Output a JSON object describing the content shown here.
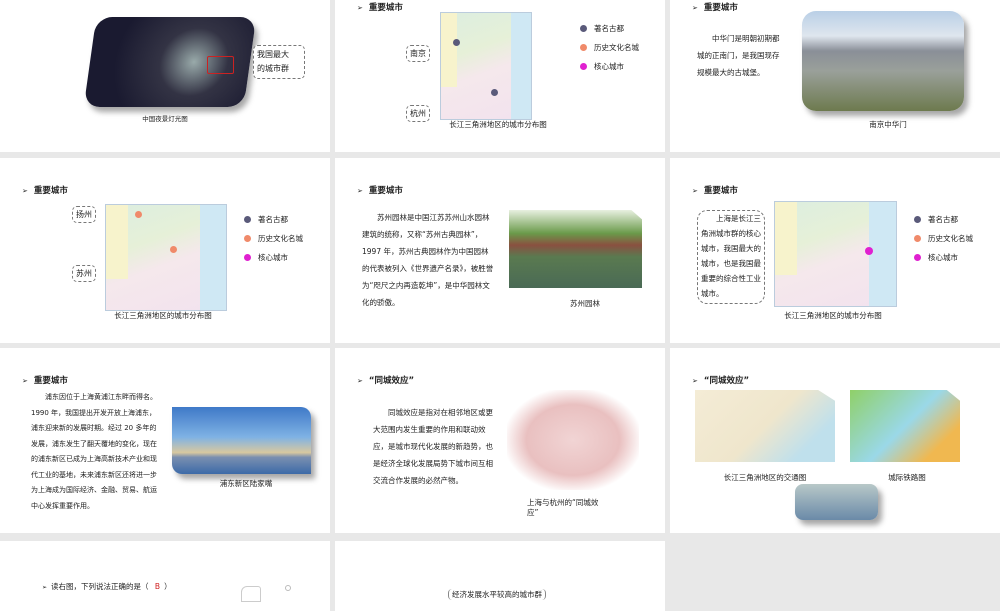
{
  "slides": [
    {
      "image_caption": "中国夜景灯光图",
      "callout": [
        "我国最大",
        "的城市群"
      ]
    },
    {
      "title": "重要城市",
      "callouts": [
        "南京",
        "杭州"
      ],
      "map_caption": "长江三角洲地区的城市分布图",
      "legend": [
        {
          "label": "著名古都",
          "color": "#5a5a7a"
        },
        {
          "label": "历史文化名城",
          "color": "#f08a6a"
        },
        {
          "label": "核心城市",
          "color": "#e020d0"
        }
      ]
    },
    {
      "title": "重要城市",
      "text": "中华门是明朝初期都城的正南门，是我国现存规模最大的古城堡。",
      "image_caption": "南京中华门"
    },
    {
      "title": "重要城市",
      "callouts": [
        "扬州",
        "苏州"
      ],
      "map_caption": "长江三角洲地区的城市分布图",
      "legend": [
        {
          "label": "著名古都",
          "color": "#5a5a7a"
        },
        {
          "label": "历史文化名城",
          "color": "#f08a6a"
        },
        {
          "label": "核心城市",
          "color": "#e020d0"
        }
      ]
    },
    {
      "title": "重要城市",
      "text": "苏州园林是中国江苏苏州山水园林建筑的统称，又称“苏州古典园林”， 1997 年，苏州古典园林作为中国园林的代表被列入《世界遗产名录》，被胜誉为“咫尺之内再造乾坤”，是中华园林文化的骄傲。",
      "image_caption": "苏州园林"
    },
    {
      "title": "重要城市",
      "callout": "上海是长江三角洲城市群的核心城市，我国最大的城市，也是我国最重要的综合性工业城市。",
      "map_caption": "长江三角洲地区的城市分布图",
      "legend": [
        {
          "label": "著名古都",
          "color": "#5a5a7a"
        },
        {
          "label": "历史文化名城",
          "color": "#f08a6a"
        },
        {
          "label": "核心城市",
          "color": "#e020d0"
        }
      ]
    },
    {
      "title": "重要城市",
      "text": "浦东因位于上海黄浦江东畔而得名。 1990 年，我国提出开发开放上海浦东，浦东迎来新的发展时期。经过 20 多年的发展，浦东发生了翻天覆地的变化，现在的浦东新区已成为上海高新技术产业和现代工业的基地，未来浦东新区还将进一步为上海成为国际经济、金融、贸易、航运中心发挥重要作用。",
      "image_caption": "浦东新区陆家嘴"
    },
    {
      "title": "“同城效应”",
      "text": "同城效应是指对在相邻地区或更大范围内发生重要的作用和联动效应，是城市现代化发展的新趋势，也是经济全球化发展局势下城市间互相交流合作发展的必然产物。",
      "image_caption": "上海与杭州的“同城效应”"
    },
    {
      "title": "“同城效应”",
      "image_captions": [
        "长江三角洲地区的交通图",
        "城际铁路图"
      ]
    },
    {
      "question": "读右图，下列说法正确的是（",
      "answer": "B",
      "question_end": "）"
    },
    {
      "label": "经济发展水平较高的城市群"
    }
  ]
}
